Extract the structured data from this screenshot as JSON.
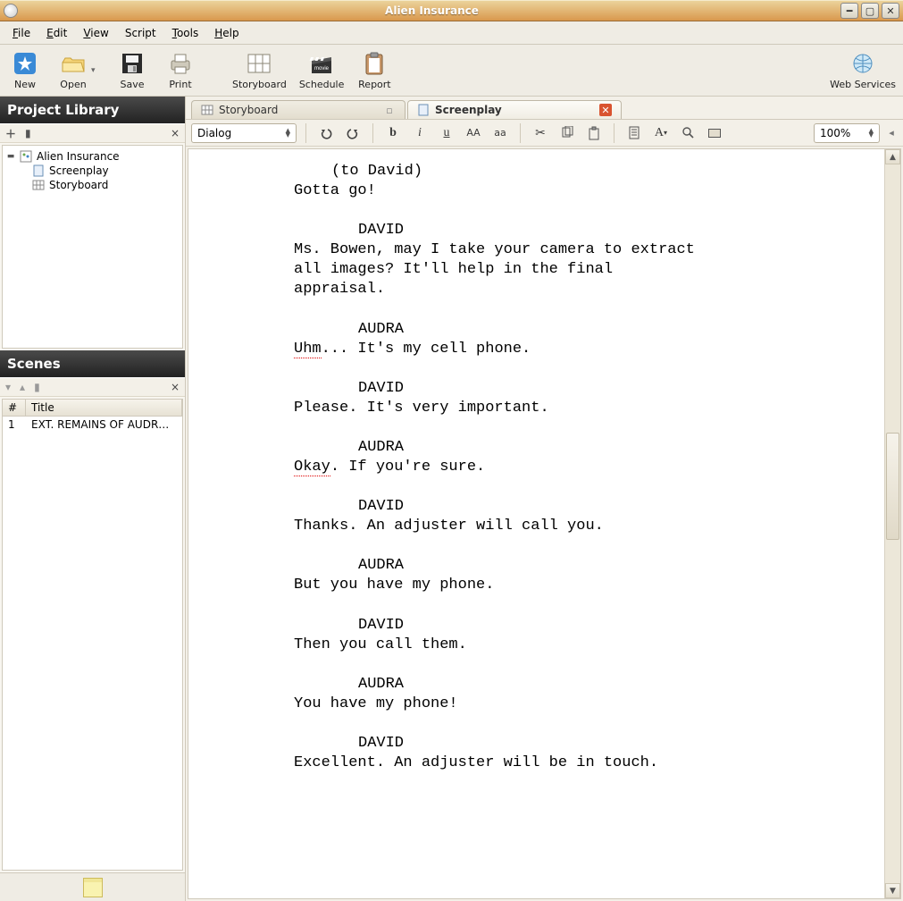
{
  "window": {
    "title": "Alien Insurance"
  },
  "menubar": {
    "file": "File",
    "edit": "Edit",
    "view": "View",
    "script": "Script",
    "tools": "Tools",
    "help": "Help"
  },
  "toolbar": {
    "new": "New",
    "open": "Open",
    "save": "Save",
    "print": "Print",
    "storyboard": "Storyboard",
    "schedule": "Schedule",
    "report": "Report",
    "webservices": "Web Services"
  },
  "sidebar": {
    "project_library_title": "Project Library",
    "tree": {
      "root": "Alien Insurance",
      "children": [
        "Screenplay",
        "Storyboard"
      ]
    },
    "scenes_title": "Scenes",
    "scenes_columns": {
      "num": "#",
      "title": "Title"
    },
    "scenes_rows": [
      {
        "num": "1",
        "title": "EXT. REMAINS OF AUDR…"
      }
    ]
  },
  "tabs": {
    "storyboard": "Storyboard",
    "screenplay": "Screenplay"
  },
  "editor": {
    "style_select": "Dialog",
    "zoom": "100%",
    "case_upper": "AA",
    "case_lower": "aa"
  },
  "screenplay": {
    "l01_paren": "(to David)",
    "l02_dialog": "Gotta go!",
    "l03_char": "DAVID",
    "l04_dialog": "Ms. Bowen, may I take your camera to extract all images? It'll help in the final appraisal.",
    "l05_char": "AUDRA",
    "l06a_word": "Uhm",
    "l06b_rest": "... It's my cell phone.",
    "l07_char": "DAVID",
    "l08_dialog": "Please. It's very important.",
    "l09_char": "AUDRA",
    "l10a_word": "Okay",
    "l10b_rest": ". If you're sure.",
    "l11_char": "DAVID",
    "l12_dialog": "Thanks. An adjuster will call you.",
    "l13_char": "AUDRA",
    "l14_dialog": "But you have my phone.",
    "l15_char": "DAVID",
    "l16_dialog": "Then you call them.",
    "l17_char": "AUDRA",
    "l18_dialog": "You have my phone!",
    "l19_char": "DAVID",
    "l20_dialog": "Excellent. An adjuster will be in touch."
  }
}
